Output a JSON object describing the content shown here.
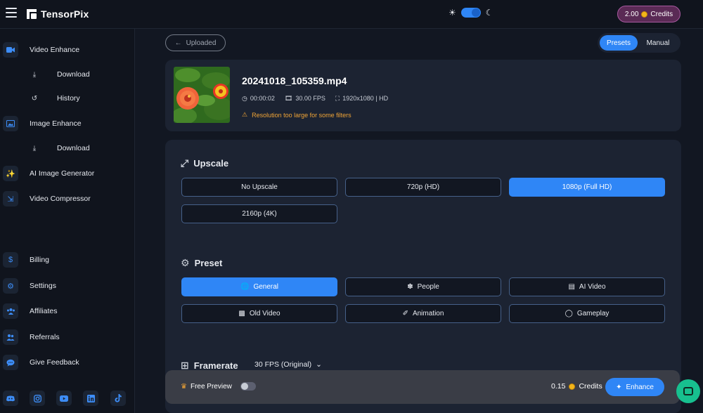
{
  "app": {
    "name": "TensorPix",
    "credits": "2.00",
    "credits_label": "Credits"
  },
  "sidebar": {
    "items": [
      {
        "label": "Video Enhance",
        "icon": "video-camera-icon"
      },
      {
        "label": "Download",
        "icon": "download-icon"
      },
      {
        "label": "History",
        "icon": "history-icon"
      },
      {
        "label": "Image Enhance",
        "icon": "image-icon"
      },
      {
        "label": "Download",
        "icon": "download-icon"
      },
      {
        "label": "AI Image Generator",
        "icon": "magic-wand-icon"
      },
      {
        "label": "Video Compressor",
        "icon": "compress-icon"
      },
      {
        "label": "Billing",
        "icon": "dollar-icon"
      },
      {
        "label": "Settings",
        "icon": "gear-icon"
      },
      {
        "label": "Affiliates",
        "icon": "users-icon"
      },
      {
        "label": "Referrals",
        "icon": "user-group-icon"
      },
      {
        "label": "Give Feedback",
        "icon": "chat-bubble-icon"
      }
    ],
    "socials": [
      "discord-icon",
      "instagram-icon",
      "youtube-icon",
      "linkedin-icon",
      "tiktok-icon"
    ]
  },
  "header": {
    "back_label": "Uploaded",
    "modes": [
      "Presets",
      "Manual"
    ],
    "active_mode": "Presets"
  },
  "file": {
    "name": "20241018_105359.mp4",
    "duration": "00:00:02",
    "fps": "30.00 FPS",
    "resolution": "1920x1080 | HD",
    "warning": "Resolution too large for some filters"
  },
  "upscale": {
    "title": "Upscale",
    "options": [
      "No Upscale",
      "720p (HD)",
      "1080p (Full HD)",
      "2160p (4K)"
    ],
    "selected": "1080p (Full HD)"
  },
  "preset": {
    "title": "Preset",
    "options": [
      "General",
      "People",
      "AI Video",
      "Old Video",
      "Animation",
      "Gameplay"
    ],
    "selected": "General"
  },
  "framerate": {
    "title": "Framerate",
    "value": "30 FPS (Original)"
  },
  "footer": {
    "free_preview_label": "Free Preview",
    "cost": "0.15",
    "cost_label": "Credits",
    "enhance_label": "Enhance"
  },
  "colors": {
    "accent": "#2f86f6",
    "warning": "#f0a436",
    "credits_pill": "#5a2a55",
    "chat": "#17c08f"
  }
}
